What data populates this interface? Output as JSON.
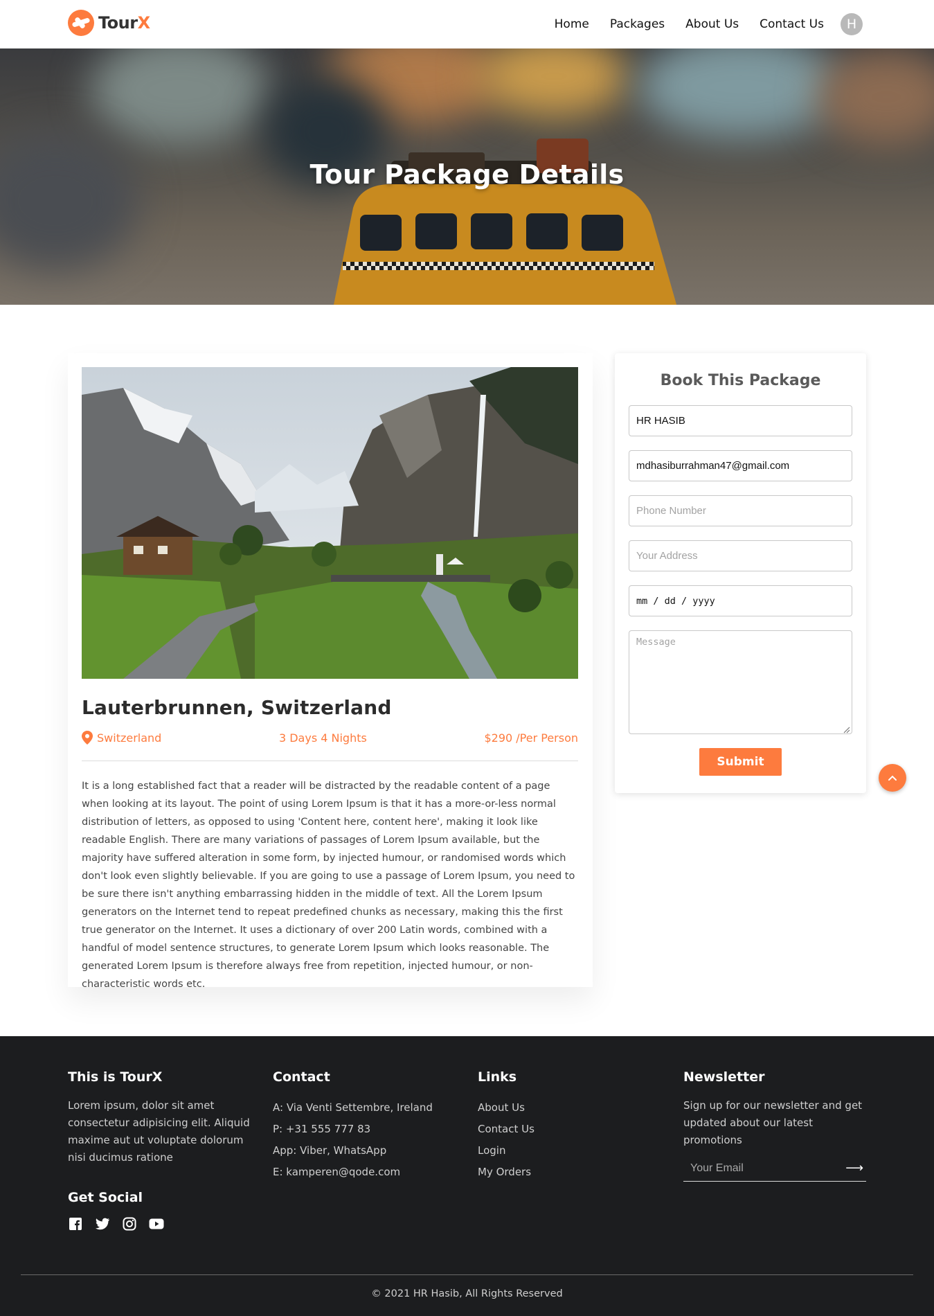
{
  "nav": {
    "brand_text": "Tour",
    "brand_accent": "X",
    "links": [
      "Home",
      "Packages",
      "About Us",
      "Contact Us"
    ],
    "avatar_initial": "H"
  },
  "hero": {
    "title": "Tour Package Details"
  },
  "package": {
    "image_icon": "mountain-valley-photo",
    "title": "Lauterbrunnen, Switzerland",
    "location": "Switzerland",
    "duration": "3 Days 4 Nights",
    "price": "$290 /Per Person",
    "description": "It is a long established fact that a reader will be distracted by the readable content of a page when looking at its layout. The point of using Lorem Ipsum is that it has a more-or-less normal distribution of letters, as opposed to using 'Content here, content here', making it look like readable English. There are many variations of passages of Lorem Ipsum available, but the majority have suffered alteration in some form, by injected humour, or randomised words which don't look even slightly believable. If you are going to use a passage of Lorem Ipsum, you need to be sure there isn't anything embarrassing hidden in the middle of text. All the Lorem Ipsum generators on the Internet tend to repeat predefined chunks as necessary, making this the first true generator on the Internet. It uses a dictionary of over 200 Latin words, combined with a handful of model sentence structures, to generate Lorem Ipsum which looks reasonable. The generated Lorem Ipsum is therefore always free from repetition, injected humour, or non-characteristic words etc."
  },
  "booking": {
    "title": "Book This Package",
    "name_value": "HR HASIB",
    "email_value": "mdhasiburrahman47@gmail.com",
    "phone_placeholder": "Phone Number",
    "address_placeholder": "Your Address",
    "date_placeholder": "mm / dd / yyyy",
    "message_placeholder": "Message",
    "submit_label": "Submit"
  },
  "footer": {
    "about_title": "This is TourX",
    "about_text": "Lorem ipsum, dolor sit amet consectetur adipisicing elit. Aliquid maxime aut ut voluptate dolorum nisi ducimus ratione",
    "social_title": "Get Social",
    "social_icons": [
      "facebook-icon",
      "twitter-icon",
      "instagram-icon",
      "youtube-icon"
    ],
    "contact_title": "Contact",
    "contact_lines": [
      "A: Via Venti Settembre, Ireland",
      "P: +31 555 777 83",
      "App: Viber, WhatsApp",
      "E: kamperen@qode.com"
    ],
    "links_title": "Links",
    "links": [
      "About Us",
      "Contact Us",
      "Login",
      "My Orders"
    ],
    "newsletter_title": "Newsletter",
    "newsletter_text": "Sign up for our newsletter and get updated about our latest promotions",
    "newsletter_placeholder": "Your Email",
    "copyright": "© 2021 HR Hasib, All Rights Reserved"
  },
  "colors": {
    "accent": "#fd7b3e",
    "footer_bg": "#1c1d1f",
    "text_dark": "#2c2c2c"
  }
}
